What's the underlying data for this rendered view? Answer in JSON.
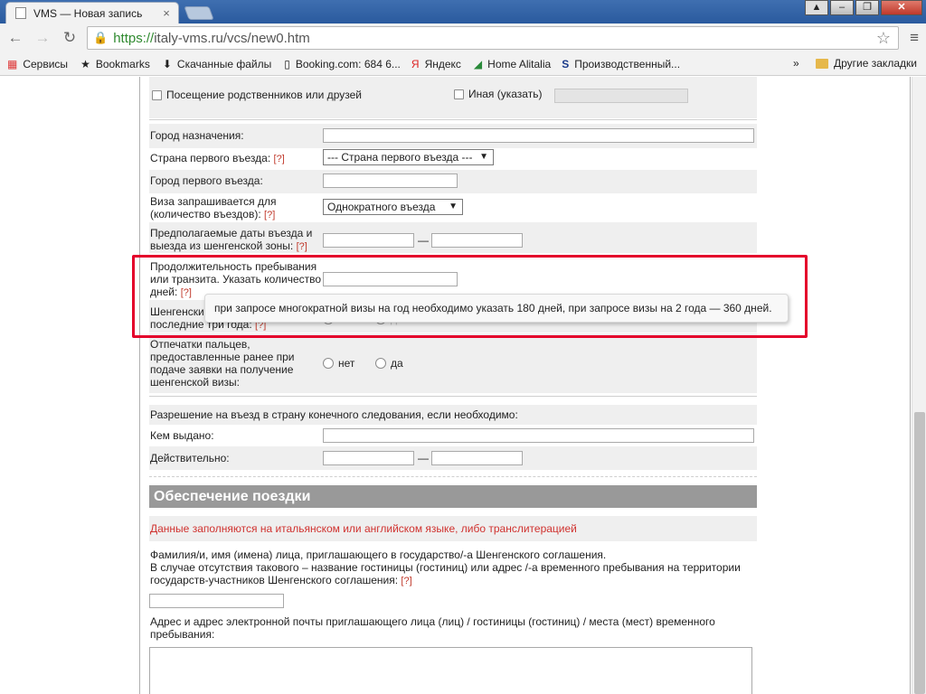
{
  "browser": {
    "tab_title": "VMS — Новая запись",
    "tab_close": "×",
    "url_https": "https://",
    "url_rest": "italy-vms.ru/vcs/new0.htm",
    "back_icon": "←",
    "forward_icon": "→",
    "reload_icon": "↻",
    "star_icon": "☆",
    "menu_icon": "≡",
    "window_minimize": "–",
    "window_maximize": "❐",
    "window_close": "✕"
  },
  "bookmarks": {
    "items": [
      {
        "icon": "apps-icon",
        "label": "Сервисы"
      },
      {
        "icon": "star-icon",
        "label": "Bookmarks"
      },
      {
        "icon": "download-icon",
        "label": "Скачанные файлы"
      },
      {
        "icon": "page-icon",
        "label": "Booking.com: 684 6..."
      },
      {
        "icon": "yandex-icon",
        "label": "Яндекс"
      },
      {
        "icon": "alitalia-icon",
        "label": "Home Alitalia"
      },
      {
        "icon": "s-icon",
        "label": "Производственный..."
      }
    ],
    "overflow": "»",
    "other": "Другие закладки"
  },
  "form": {
    "visit_relatives": "Посещение родственников или друзей",
    "other_specify": "Иная (указать)",
    "destination_city": "Город назначения:",
    "first_entry_country": "Страна первого въезда:",
    "first_entry_country_select": "--- Страна первого въезда ---",
    "first_entry_city": "Город первого въезда:",
    "visa_entries_line1": "Виза запрашивается для",
    "visa_entries_line2": "(количество въездов):",
    "visa_entries_select": "Однократного въезда",
    "dates_line1": "Предполагаемые даты въезда и",
    "dates_line2": "выезда из шенгенской зоны:",
    "duration_line1": "Продолжительность пребывания",
    "duration_line2": "или транзита. Указать количество",
    "duration_line3": "дней:",
    "schengen_line1": "Шенгенские визы, выданные за",
    "schengen_line2": "последние три года:",
    "no": "нет",
    "yes": "да",
    "fingerprints_line1": "Отпечатки пальцев,",
    "fingerprints_line2": "предоставленные ранее при",
    "fingerprints_line3": "подаче заявки на получение",
    "fingerprints_line4": "шенгенской визы:",
    "permit_title": "Разрешение на въезд в страну конечного следования, если необходимо:",
    "issued_by": "Кем выдано:",
    "valid": "Действительно:",
    "help_mark": "[?]",
    "dash": "—"
  },
  "tooltip": "при запросе многократной визы на год необходимо указать 180 дней, при запросе визы на 2 года — 360 дней.",
  "section": {
    "title": "Обеспечение поездки",
    "note": "Данные заполняются на итальянском или английском языке, либо транслитерацией",
    "inviter_line1": "Фамилия/и, имя (имена) лица, приглашающего в государство/-а Шенгенского соглашения.",
    "inviter_line2": "В случае отсутствия такового – название гостиницы (гостиниц) или адрес /-а временного пребывания на территории",
    "inviter_line3": "государств-участников Шенгенского соглашения:",
    "address_line1": "Адрес и адрес электронной почты приглашающего лица (лиц) / гостиницы (гостиниц) / места (мест) временного",
    "address_line2": "пребывания:"
  }
}
